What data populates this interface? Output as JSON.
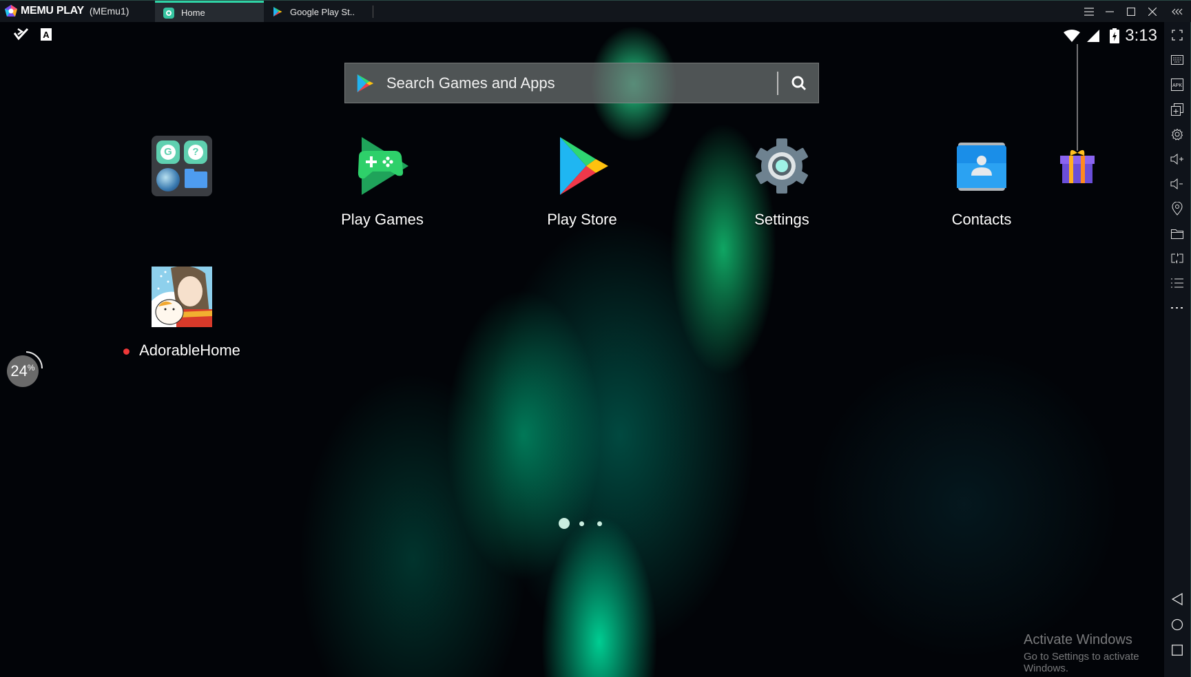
{
  "window": {
    "brand": "MEMU PLAY",
    "instance": "(MEmu1)",
    "tabs": [
      {
        "label": "Home",
        "icon": "home-app-icon",
        "active": true
      },
      {
        "label": "Google Play St..",
        "icon": "play-store-icon",
        "active": false
      }
    ],
    "controls": [
      "menu-icon",
      "minimize-icon",
      "maximize-icon",
      "close-icon",
      "collapse-sidebar-icon"
    ]
  },
  "toolbar_left": [
    "checkmark-tool-icon",
    "text-input-icon"
  ],
  "statusbar": {
    "time": "3:13",
    "icons": [
      "wifi-icon",
      "signal-icon",
      "battery-charging-icon"
    ]
  },
  "search": {
    "placeholder": "Search Games and Apps"
  },
  "apps": [
    {
      "label": "",
      "type": "folder",
      "contents": [
        "Google",
        "Help",
        "Browser",
        "Files"
      ]
    },
    {
      "label": "Play Games"
    },
    {
      "label": "Play Store"
    },
    {
      "label": "Settings"
    },
    {
      "label": "Contacts"
    }
  ],
  "second_row": [
    {
      "label": "AdorableHome",
      "new_indicator": true
    }
  ],
  "performance": {
    "value": "24",
    "unit": "%"
  },
  "pager": {
    "pages": 3,
    "current": 1
  },
  "sidebar": {
    "items": [
      "fullscreen-icon",
      "keyboard-icon",
      "apk-install-icon",
      "multi-instance-icon",
      "settings-icon",
      "volume-up-icon",
      "volume-down-icon",
      "location-icon",
      "folder-icon",
      "sync-icon",
      "list-icon",
      "more-icon"
    ],
    "nav": [
      "back-icon",
      "home-icon",
      "recent-apps-icon"
    ]
  },
  "watermark": {
    "title": "Activate Windows",
    "subtitle": "Go to Settings to activate Windows."
  },
  "colors": {
    "accent": "#2fd4a6",
    "titlebar": "#12161c",
    "notification_dot": "#ee3838"
  }
}
